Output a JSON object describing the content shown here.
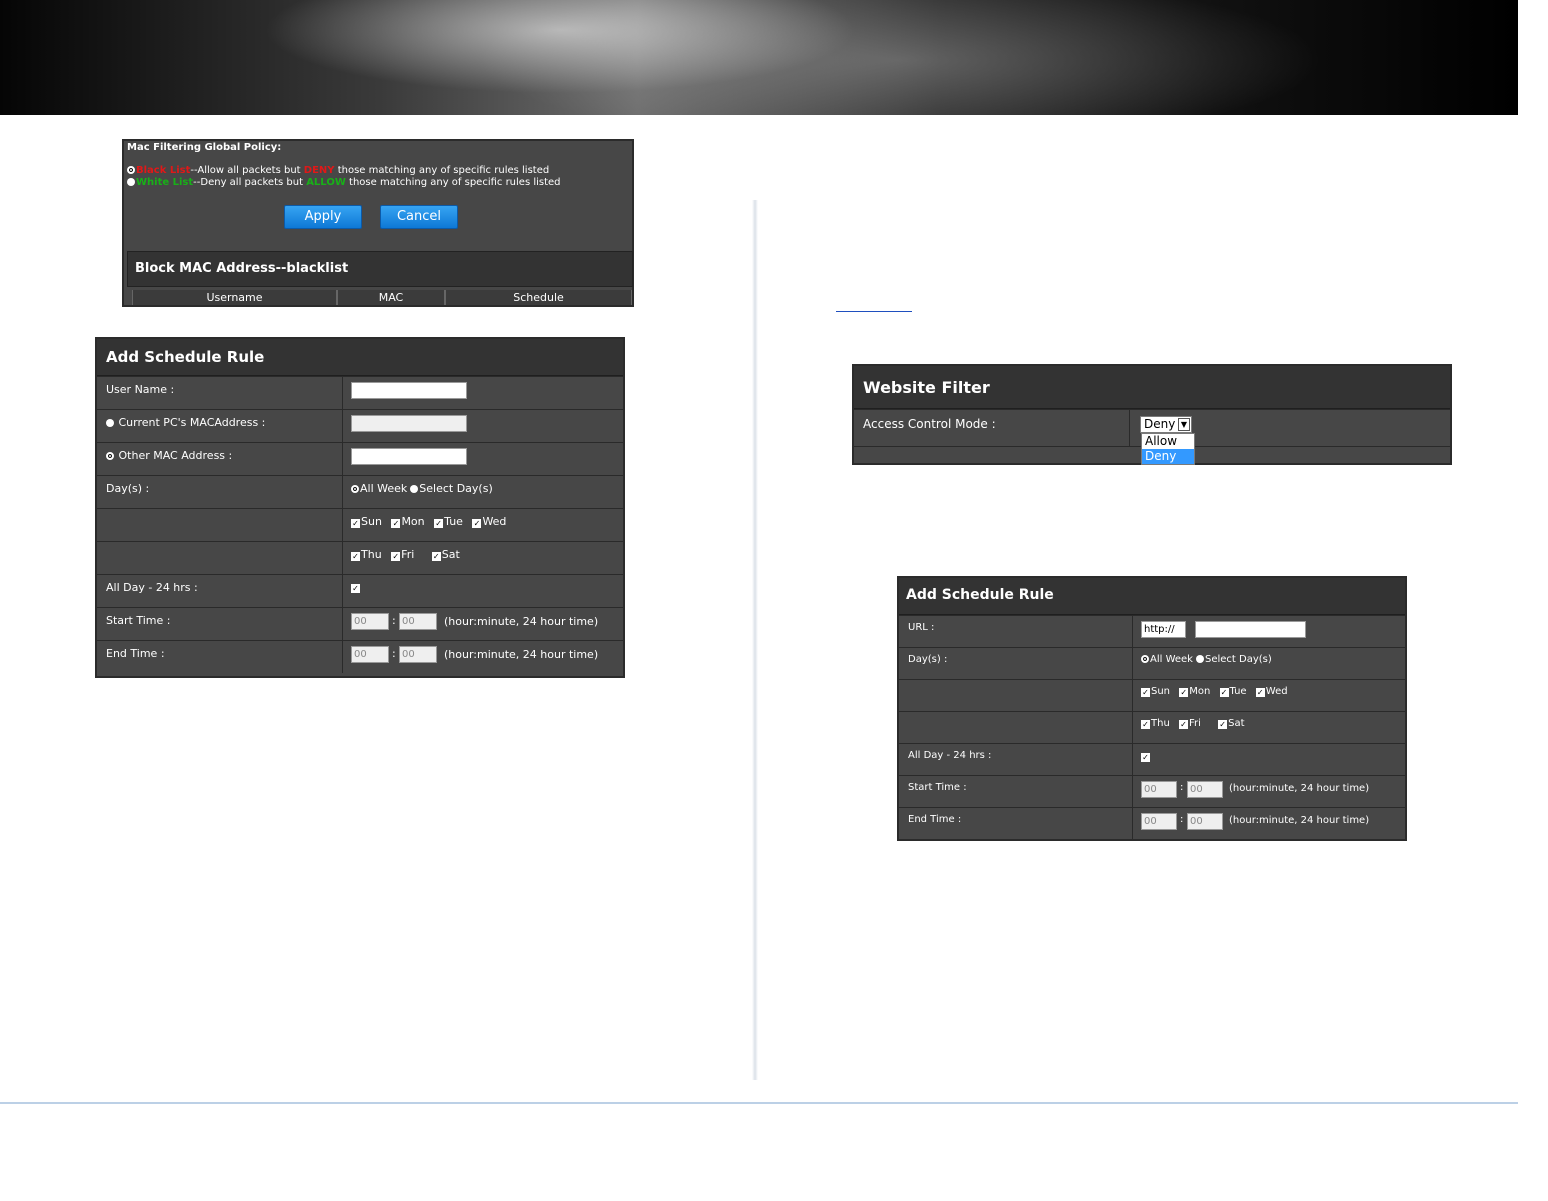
{
  "mac_policy": {
    "title": "Mac Filtering Global Policy:",
    "option1": {
      "tag": "Black List",
      "pre": "--Allow all packets but ",
      "keyword": "DENY",
      "post": " those matching any of specific rules listed"
    },
    "option2": {
      "tag": "White List",
      "pre": "--Deny all packets but ",
      "keyword": "ALLOW",
      "post": " those matching any of specific rules listed"
    },
    "apply_label": "Apply",
    "cancel_label": "Cancel",
    "blocklist_title": "Block MAC Address--blacklist",
    "columns": [
      "Username",
      "MAC",
      "Schedule"
    ]
  },
  "schedule_mac": {
    "title": "Add Schedule Rule",
    "user_name_label": "User Name :",
    "current_mac_label": "Current PC's MACAddress :",
    "other_mac_label": "Other MAC Address :",
    "days_label": "Day(s) :",
    "all_week": "All Week",
    "select_days": "Select Day(s)",
    "days_row1": [
      "Sun",
      "Mon",
      "Tue",
      "Wed"
    ],
    "days_row2": [
      "Thu",
      "Fri",
      "Sat"
    ],
    "allday_label": "All Day - 24 hrs :",
    "start_label": "Start Time :",
    "end_label": "End Time :",
    "time_value": "00",
    "time_hint": "(hour:minute, 24 hour time)"
  },
  "website_filter": {
    "title": "Website Filter",
    "mode_label": "Access Control Mode :",
    "selected": "Deny",
    "options": [
      "Allow",
      "Deny"
    ]
  },
  "schedule_url": {
    "title": "Add Schedule Rule",
    "url_label": "URL :",
    "url_prefix": "http://",
    "days_label": "Day(s) :",
    "all_week": "All Week",
    "select_days": "Select Day(s)",
    "days_row1": [
      "Sun",
      "Mon",
      "Tue",
      "Wed"
    ],
    "days_row2": [
      "Thu",
      "Fri",
      "Sat"
    ],
    "allday_label": "All Day - 24 hrs :",
    "start_label": "Start Time :",
    "end_label": "End Time :",
    "time_value": "00",
    "time_hint": "(hour:minute, 24 hour time)"
  },
  "colors": {
    "deny": "#e01818",
    "allow": "#18b018",
    "panel": "#474747",
    "button": "#1a88e0"
  }
}
